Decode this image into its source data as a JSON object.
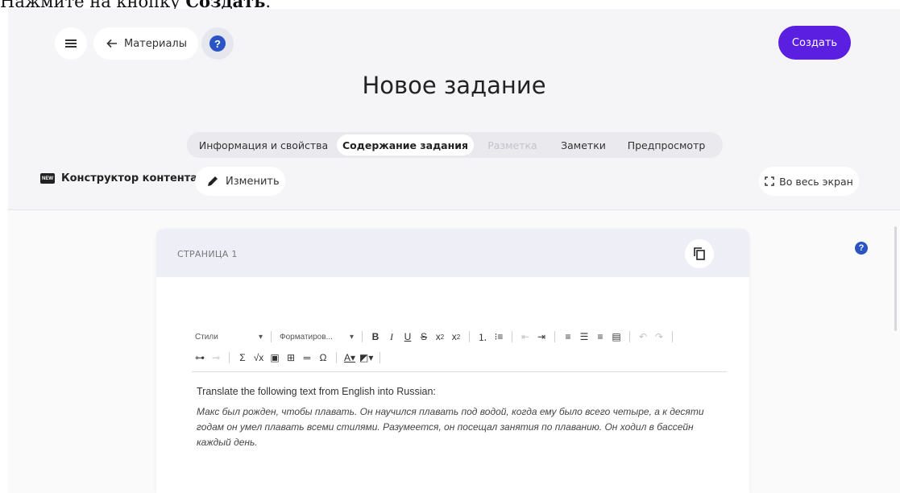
{
  "instruction": {
    "prefix": "Нажмите на кнопку ",
    "bold": "Создать",
    "suffix": "."
  },
  "header": {
    "back_label": "Материалы",
    "help_symbol": "?",
    "create_label": "Создать",
    "title": "Новое задание"
  },
  "tabs": [
    {
      "label": "Информация и свойства",
      "state": "normal"
    },
    {
      "label": "Содержание задания",
      "state": "active"
    },
    {
      "label": "Разметка",
      "state": "disabled"
    },
    {
      "label": "Заметки",
      "state": "normal"
    },
    {
      "label": "Предпросмотр",
      "state": "normal"
    }
  ],
  "toolbar": {
    "constructor_badge": "NEW",
    "constructor_label": "Конструктор контента",
    "edit_label": "Изменить",
    "fullscreen_label": "Во весь экран"
  },
  "page": {
    "label": "СТРАНИЦА 1"
  },
  "editor": {
    "styles_label": "Стили",
    "format_label": "Форматиров...",
    "paragraph1": "Translate the following text from English into Russian:",
    "paragraph2": "Макс был рожден, чтобы плавать. Он научился плавать под водой, когда ему было всего четыре, а к десяти годам он умел плавать всеми стилями. Разумеется, он посещал занятия по плаванию. Он ходил в бассейн каждый день."
  },
  "colors": {
    "accent": "#5a1fe0",
    "help_blue": "#2a54c4",
    "app_bg": "#f5f5f7"
  },
  "icons": [
    "hamburger-icon",
    "arrow-left-icon",
    "question-icon",
    "pencil-icon",
    "fullscreen-icon",
    "copy-icon"
  ]
}
